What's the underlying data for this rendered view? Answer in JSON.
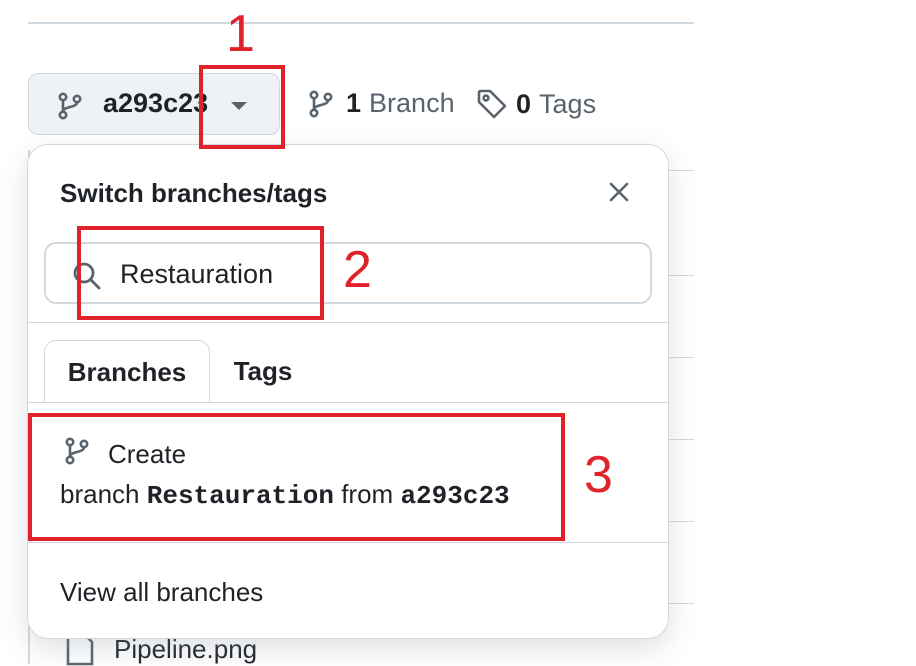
{
  "ref_selector": {
    "current_ref": "a293c23"
  },
  "stats": {
    "branches_count": "1",
    "branches_label": "Branch",
    "tags_count": "0",
    "tags_label": "Tags"
  },
  "popover": {
    "title": "Switch branches/tags",
    "search_value": "Restauration",
    "tabs": [
      {
        "label": "Branches",
        "active": true
      },
      {
        "label": "Tags",
        "active": false
      }
    ],
    "create_label": "Create",
    "create_prefix": "branch",
    "create_branch_name": "Restauration",
    "create_middle": "from",
    "create_source": "a293c23",
    "view_all": "View all branches"
  },
  "file_list": {
    "visible_file": "Pipeline.png"
  },
  "annotations": {
    "step1": "1",
    "step2": "2",
    "step3": "3",
    "color": "#e0232b"
  },
  "icons": {
    "branch": "git-branch-icon",
    "caret": "caret-down-icon",
    "tag": "tag-icon",
    "close": "x-icon",
    "search": "search-icon",
    "file": "file-icon"
  }
}
